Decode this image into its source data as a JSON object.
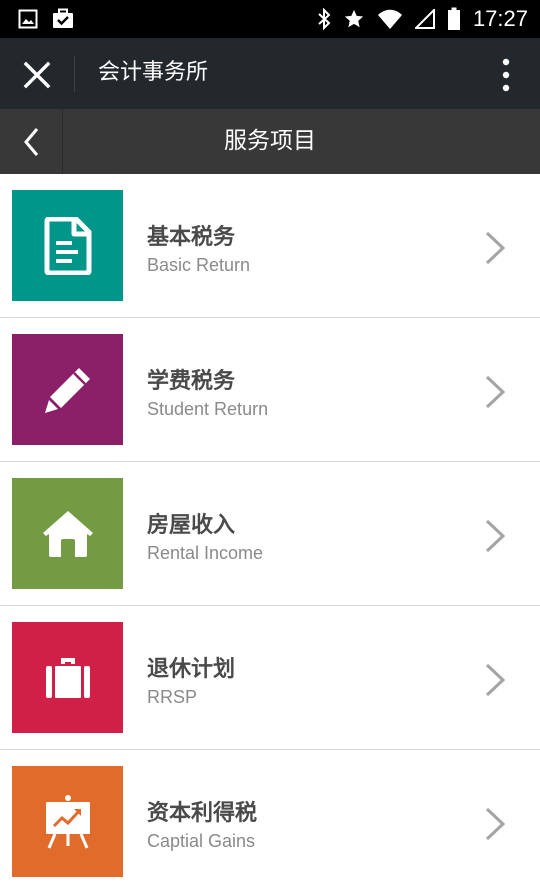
{
  "status_bar": {
    "time": "17:27",
    "icons": [
      "gallery-icon",
      "briefcase-check-icon",
      "bluetooth-icon",
      "star-icon",
      "wifi-icon",
      "signal-icon",
      "battery-icon"
    ]
  },
  "app_bar": {
    "title": "会计事务所",
    "close_icon": "close-icon",
    "menu_icon": "more-vert-icon"
  },
  "sub_bar": {
    "title": "服务项目",
    "back_icon": "chevron-left-icon"
  },
  "services": [
    {
      "title_zh": "基本税务",
      "title_en": "Basic Return",
      "icon": "document-icon",
      "color": "#00968a"
    },
    {
      "title_zh": "学费税务",
      "title_en": "Student Return",
      "icon": "pencil-icon",
      "color": "#8c2068"
    },
    {
      "title_zh": "房屋收入",
      "title_en": "Rental Income",
      "icon": "home-icon",
      "color": "#729b43"
    },
    {
      "title_zh": "退休计划",
      "title_en": "RRSP",
      "icon": "suitcase-icon",
      "color": "#d12048"
    },
    {
      "title_zh": "资本利得税",
      "title_en": "Captial Gains",
      "icon": "presentation-chart-icon",
      "color": "#e06b2b"
    }
  ]
}
